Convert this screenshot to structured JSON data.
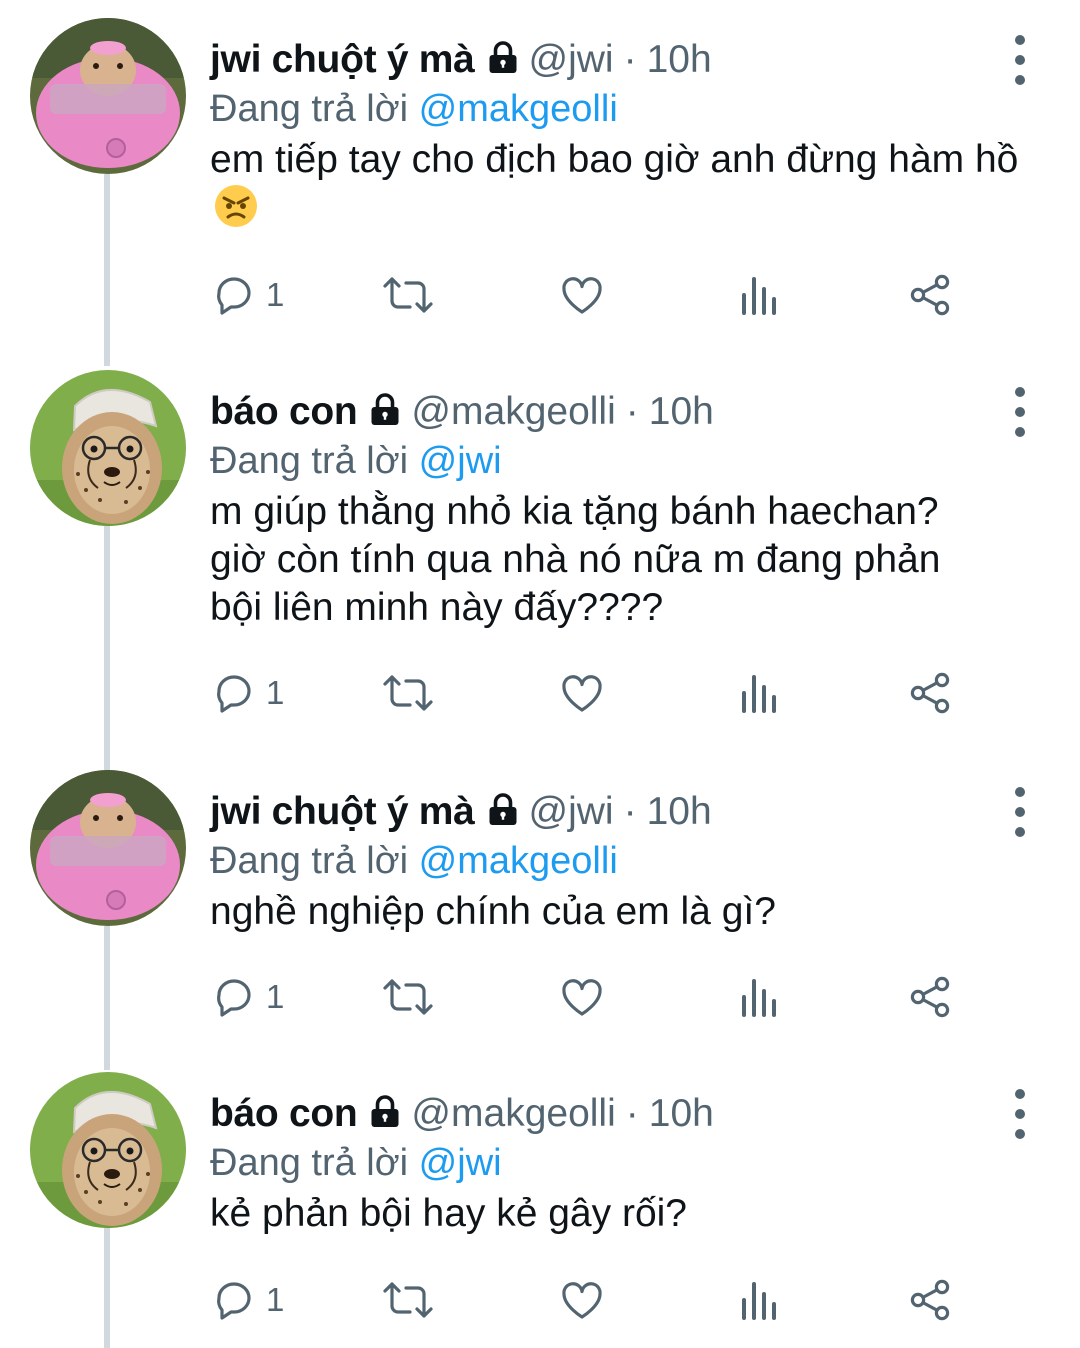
{
  "tweets": [
    {
      "name": "jwi chuột ý mà",
      "handle": "@jwi",
      "dot": "·",
      "time": "10h",
      "reply_prefix": "Đang trả lời",
      "reply_to": "@makgeolli",
      "text": "em tiếp tay cho địch bao giờ anh đừng hàm hồ",
      "emoji": "angry-face-emoji",
      "reply_count": "1",
      "avatar": "hamster-in-pink-car"
    },
    {
      "name": "báo con",
      "handle": "@makgeolli",
      "dot": "·",
      "time": "10h",
      "reply_prefix": "Đang trả lời",
      "reply_to": "@jwi",
      "text": "m giúp thằng nhỏ kia tặng bánh haechan? giờ còn tính qua nhà nó nữa m đang phản bội liên minh này đấy????",
      "reply_count": "1",
      "avatar": "cheetah-cub-with-cap-and-glasses"
    },
    {
      "name": "jwi chuột ý mà",
      "handle": "@jwi",
      "dot": "·",
      "time": "10h",
      "reply_prefix": "Đang trả lời",
      "reply_to": "@makgeolli",
      "text": "nghề nghiệp chính của em là gì?",
      "reply_count": "1",
      "avatar": "hamster-in-pink-car"
    },
    {
      "name": "báo con",
      "handle": "@makgeolli",
      "dot": "·",
      "time": "10h",
      "reply_prefix": "Đang trả lời",
      "reply_to": "@jwi",
      "text": "kẻ phản bội hay kẻ gây rối?",
      "reply_count": "1",
      "avatar": "cheetah-cub-with-cap-and-glasses"
    }
  ],
  "colors": {
    "text": "#0f1419",
    "secondary": "#536471",
    "mention": "#1d9bf0",
    "thread_line": "#cfd9de"
  },
  "icons": [
    "lock-icon",
    "more-icon",
    "reply-icon",
    "retweet-icon",
    "like-icon",
    "views-icon",
    "share-icon"
  ]
}
